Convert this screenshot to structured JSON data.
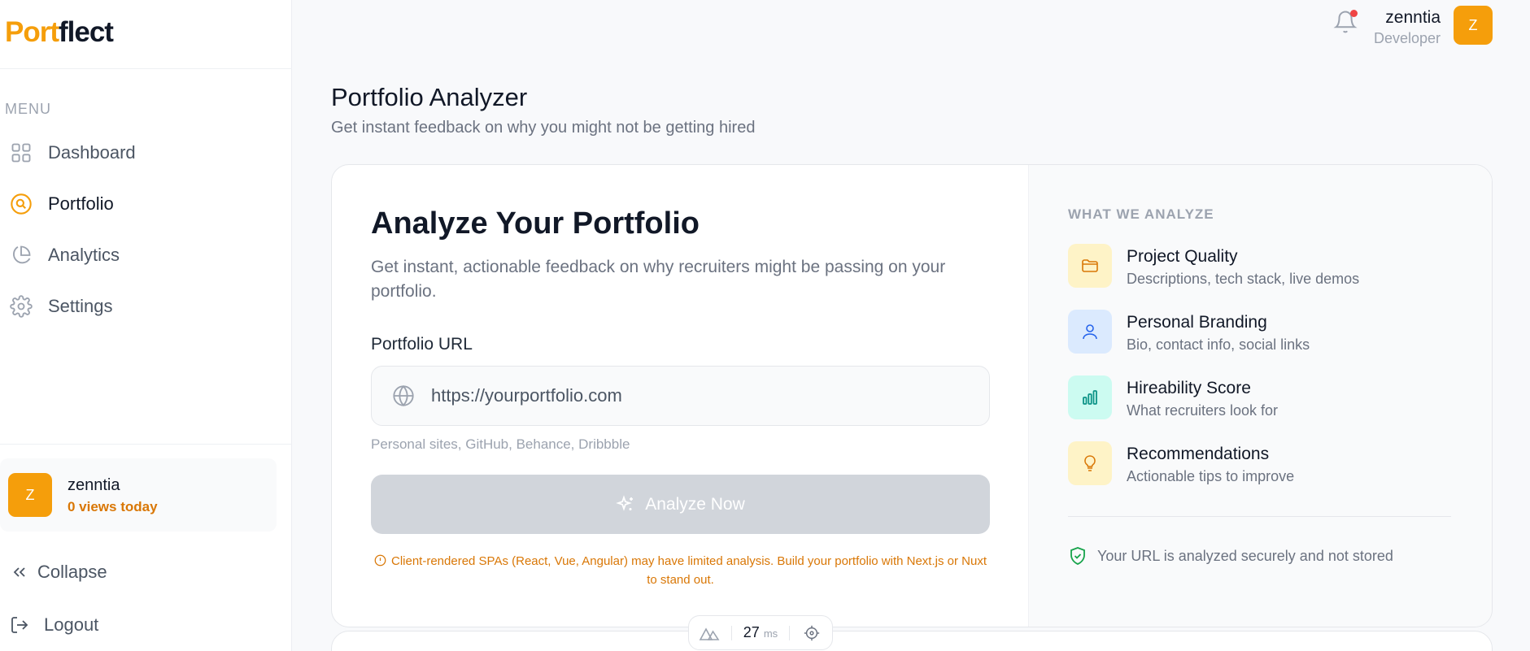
{
  "brand": {
    "logo_part1": "Port",
    "logo_part2": "flect"
  },
  "sidebar": {
    "menu_label": "MENU",
    "items": [
      {
        "label": "Dashboard",
        "icon": "grid-icon"
      },
      {
        "label": "Portfolio",
        "icon": "search-circle-icon",
        "active": true
      },
      {
        "label": "Analytics",
        "icon": "pie-chart-icon"
      },
      {
        "label": "Settings",
        "icon": "gear-icon"
      }
    ],
    "user": {
      "initial": "Z",
      "name": "zenntia",
      "views": "0 views today"
    },
    "collapse_label": "Collapse",
    "logout_label": "Logout"
  },
  "header": {
    "name": "zenntia",
    "role": "Developer",
    "initial": "Z"
  },
  "page": {
    "title": "Portfolio Analyzer",
    "subtitle": "Get instant feedback on why you might not be getting hired"
  },
  "analyzer": {
    "title": "Analyze Your Portfolio",
    "description": "Get instant, actionable feedback on why recruiters might be passing on your portfolio.",
    "url_label": "Portfolio URL",
    "url_placeholder": "https://yourportfolio.com",
    "url_value": "",
    "hint": "Personal sites, GitHub, Behance, Dribbble",
    "button_label": "Analyze Now",
    "warning": "Client-rendered SPAs (React, Vue, Angular) may have limited analysis. Build your portfolio with Next.js or Nuxt to stand out."
  },
  "what_we_analyze": {
    "heading": "WHAT WE ANALYZE",
    "items": [
      {
        "title": "Project Quality",
        "desc": "Descriptions, tech stack, live demos",
        "icon": "folder-icon",
        "bg": "#fef3c7",
        "fg": "#d97706"
      },
      {
        "title": "Personal Branding",
        "desc": "Bio, contact info, social links",
        "icon": "user-icon",
        "bg": "#dbeafe",
        "fg": "#2563eb"
      },
      {
        "title": "Hireability Score",
        "desc": "What recruiters look for",
        "icon": "bar-chart-icon",
        "bg": "#ccfbf1",
        "fg": "#0d9488"
      },
      {
        "title": "Recommendations",
        "desc": "Actionable tips to improve",
        "icon": "lightbulb-icon",
        "bg": "#fef3c7",
        "fg": "#d97706"
      }
    ],
    "secure_note": "Your URL is analyzed securely and not stored"
  },
  "dev_overlay": {
    "time": "27",
    "unit": "ms"
  },
  "colors": {
    "accent": "#f59e0b",
    "accent_text": "#d97706",
    "button_disabled": "#d1d5db",
    "notification_dot": "#ef4444"
  }
}
